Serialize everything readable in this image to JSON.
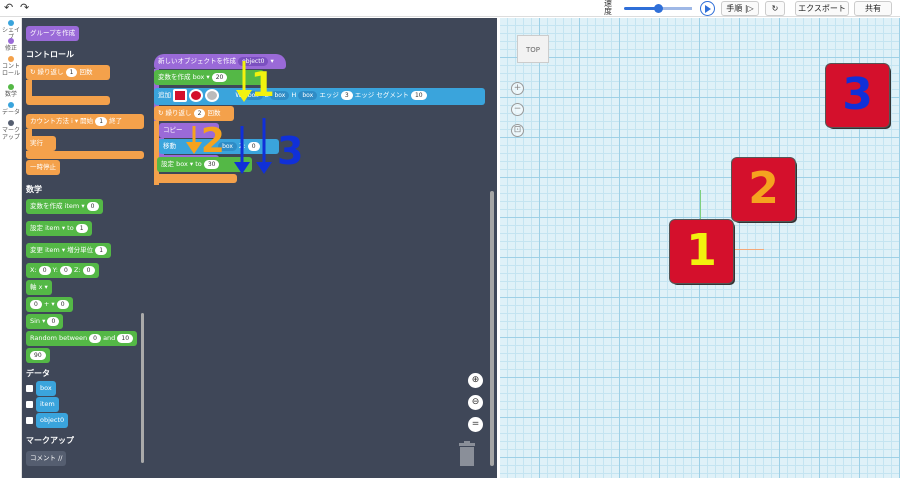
{
  "topbar": {
    "back_icon": "arrow-left",
    "forward_icon": "arrow-right",
    "speed_label": "速度",
    "speed_value": 0.5,
    "play_icon": "play",
    "step_label": "手順",
    "reset_icon": "refresh",
    "export_label": "エクスポート",
    "share_label": "共有"
  },
  "categories": [
    {
      "label": "シェイプ",
      "color": "#3aa4dc"
    },
    {
      "label": "修正",
      "color": "#9a6ad8"
    },
    {
      "label": "コントロール",
      "color": "#f4a14b"
    },
    {
      "label": "数学",
      "color": "#54b846"
    },
    {
      "label": "データ",
      "color": "#3aa4dc"
    },
    {
      "label": "マークアップ",
      "color": "#555e70"
    }
  ],
  "flyout": {
    "group_create": "グループを作成",
    "control_heading": "コントロール",
    "repeat": "繰り返し",
    "repeat_count": "1",
    "repeat_unit": "回数",
    "count_method": "カウント方法",
    "count_var": "i",
    "count_start": "開始",
    "count_start_val": "1",
    "count_end": "終了",
    "exec": "実行",
    "pause": "一時停止",
    "math_heading": "数学",
    "create_var": "変数を作成",
    "var_item": "item",
    "create_var_val": "0",
    "set": "設定",
    "to": "to",
    "set_val": "1",
    "change": "変更",
    "increment": "増分単位",
    "change_val": "1",
    "x": "X:",
    "x_val": "0",
    "y": "Y:",
    "y_val": "0",
    "z": "Z:",
    "z_val": "0",
    "axis": "軸 x",
    "op_left": "0",
    "op": "+",
    "op_right": "0",
    "sin": "Sin",
    "sin_val": "0",
    "random": "Random between",
    "random_from": "0",
    "random_and": "and",
    "random_to": "10",
    "num90": "90",
    "data_heading": "データ",
    "data_items": [
      "box",
      "item",
      "object0"
    ],
    "markup_heading": "マークアップ",
    "comment": "コメント //"
  },
  "workspace": {
    "new_object": "新しいオブジェクトを作成",
    "new_object_var": "object0",
    "create_var": "変数を作成",
    "box_var": "box",
    "create_var_val": "20",
    "add": "追加",
    "w_label": "W",
    "l_label": "L",
    "h_label": "H",
    "edge": "エッジ",
    "edge_val": "3",
    "edge_seg": "エッジ セグメント",
    "edge_seg_val": "10",
    "repeat": "繰り返し",
    "repeat_count": "2",
    "repeat_unit": "回数",
    "copy": "コピー",
    "move": "移動",
    "move_z": "Z:",
    "move_z_val": "0",
    "set": "設定",
    "set_to": "to",
    "set_val": "30",
    "annot_1": "1",
    "annot_2": "2",
    "annot_3": "3",
    "zoom_in_icon": "zoom-in",
    "zoom_out_icon": "zoom-out",
    "zoom_reset_icon": "equals",
    "trash_icon": "trash"
  },
  "viewer": {
    "viewcube": "TOP",
    "cube_1": "1",
    "cube_2": "2",
    "cube_3": "3",
    "controls": [
      "+",
      "−",
      "⊡"
    ]
  },
  "colors": {
    "flyout_bg": "#3f4758",
    "cube_red": "#d4102c",
    "annot_yellow": "#f2f20e",
    "annot_orange": "#f5a31f",
    "annot_blue": "#1030d8"
  }
}
